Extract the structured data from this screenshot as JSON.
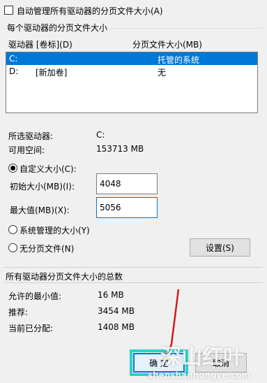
{
  "auto_manage": {
    "label": "自动管理所有驱动器的分页文件大小(A)",
    "checked": false
  },
  "paging_group": {
    "title": "每个驱动器的分页文件大小",
    "columns": [
      "驱动器 [卷标](D)",
      "分页文件大小(MB)"
    ],
    "rows": [
      {
        "drive": "C:",
        "volume": "",
        "size": "托管的系统",
        "selected": true
      },
      {
        "drive": "D:",
        "volume": "[新加卷]",
        "size": "无",
        "selected": false
      }
    ],
    "selected_drive_label": "所选驱动器:",
    "selected_drive_value": "C:",
    "free_space_label": "可用空间:",
    "free_space_value": "153713 MB",
    "custom_size_label": "自定义大小(C):",
    "initial_size_label": "初始大小(MB)(I):",
    "initial_size_value": "4048",
    "max_size_label": "最大值(MB)(X):",
    "max_size_value": "5056",
    "system_managed_label": "系统管理的大小(Y)",
    "no_paging_label": "无分页文件(N)",
    "set_button": "设置(S)"
  },
  "totals_group": {
    "title": "所有驱动器分页文件大小的总数",
    "min_label": "允许的最小值:",
    "min_value": "16 MB",
    "recommended_label": "推荐:",
    "recommended_value": "3454 MB",
    "allocated_label": "当前已分配:",
    "allocated_value": "1408 MB"
  },
  "buttons": {
    "ok": "确 定",
    "cancel": "取消"
  },
  "watermark": {
    "brand": "深山红叶",
    "url": "shenshanhongye.com"
  },
  "colors": {
    "highlight": "#0078d7",
    "annotation_box": "#2bd2c9",
    "arrow": "#d21a1a"
  }
}
